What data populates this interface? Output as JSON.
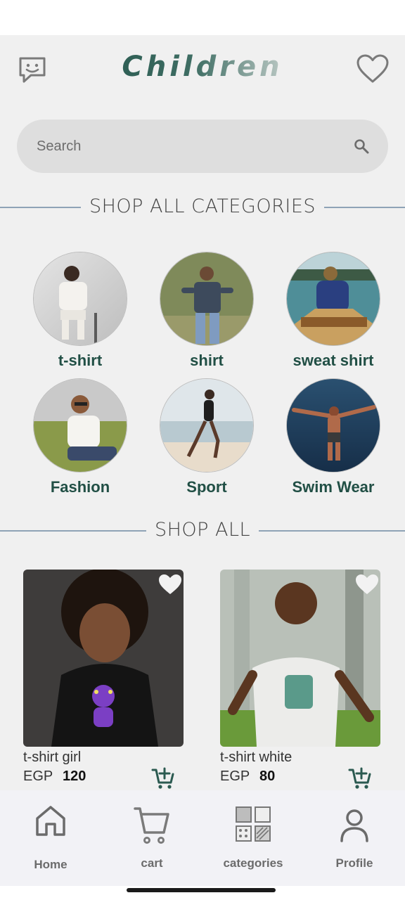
{
  "header": {
    "brand": "Children",
    "chat_icon": "chat-smile-icon",
    "heart_icon": "heart-outline-icon"
  },
  "search": {
    "placeholder": "Search",
    "icon": "search-icon"
  },
  "categories_section": {
    "title": "SHOP ALL CATEGORIES",
    "items": [
      {
        "label": "t-shirt"
      },
      {
        "label": "shirt"
      },
      {
        "label": "sweat shirt"
      },
      {
        "label": "Fashion"
      },
      {
        "label": "Sport"
      },
      {
        "label": "Swim Wear"
      }
    ]
  },
  "shop_all_section": {
    "title": "SHOP ALL",
    "products": [
      {
        "name": "t-shirt girl",
        "currency": "EGP",
        "price": "120"
      },
      {
        "name": "t-shirt white",
        "currency": "EGP",
        "price": "80"
      }
    ]
  },
  "bottom_nav": {
    "items": [
      {
        "label": "Home",
        "icon": "home-icon"
      },
      {
        "label": "cart",
        "icon": "cart-icon"
      },
      {
        "label": "categories",
        "icon": "categories-grid-icon"
      },
      {
        "label": "Profile",
        "icon": "profile-icon"
      }
    ]
  },
  "colors": {
    "background": "#f0f0f0",
    "accent_green": "#214f45",
    "divider": "#8fa3b6",
    "search_bg": "#dedede",
    "nav_bg": "#f2f2f6"
  }
}
